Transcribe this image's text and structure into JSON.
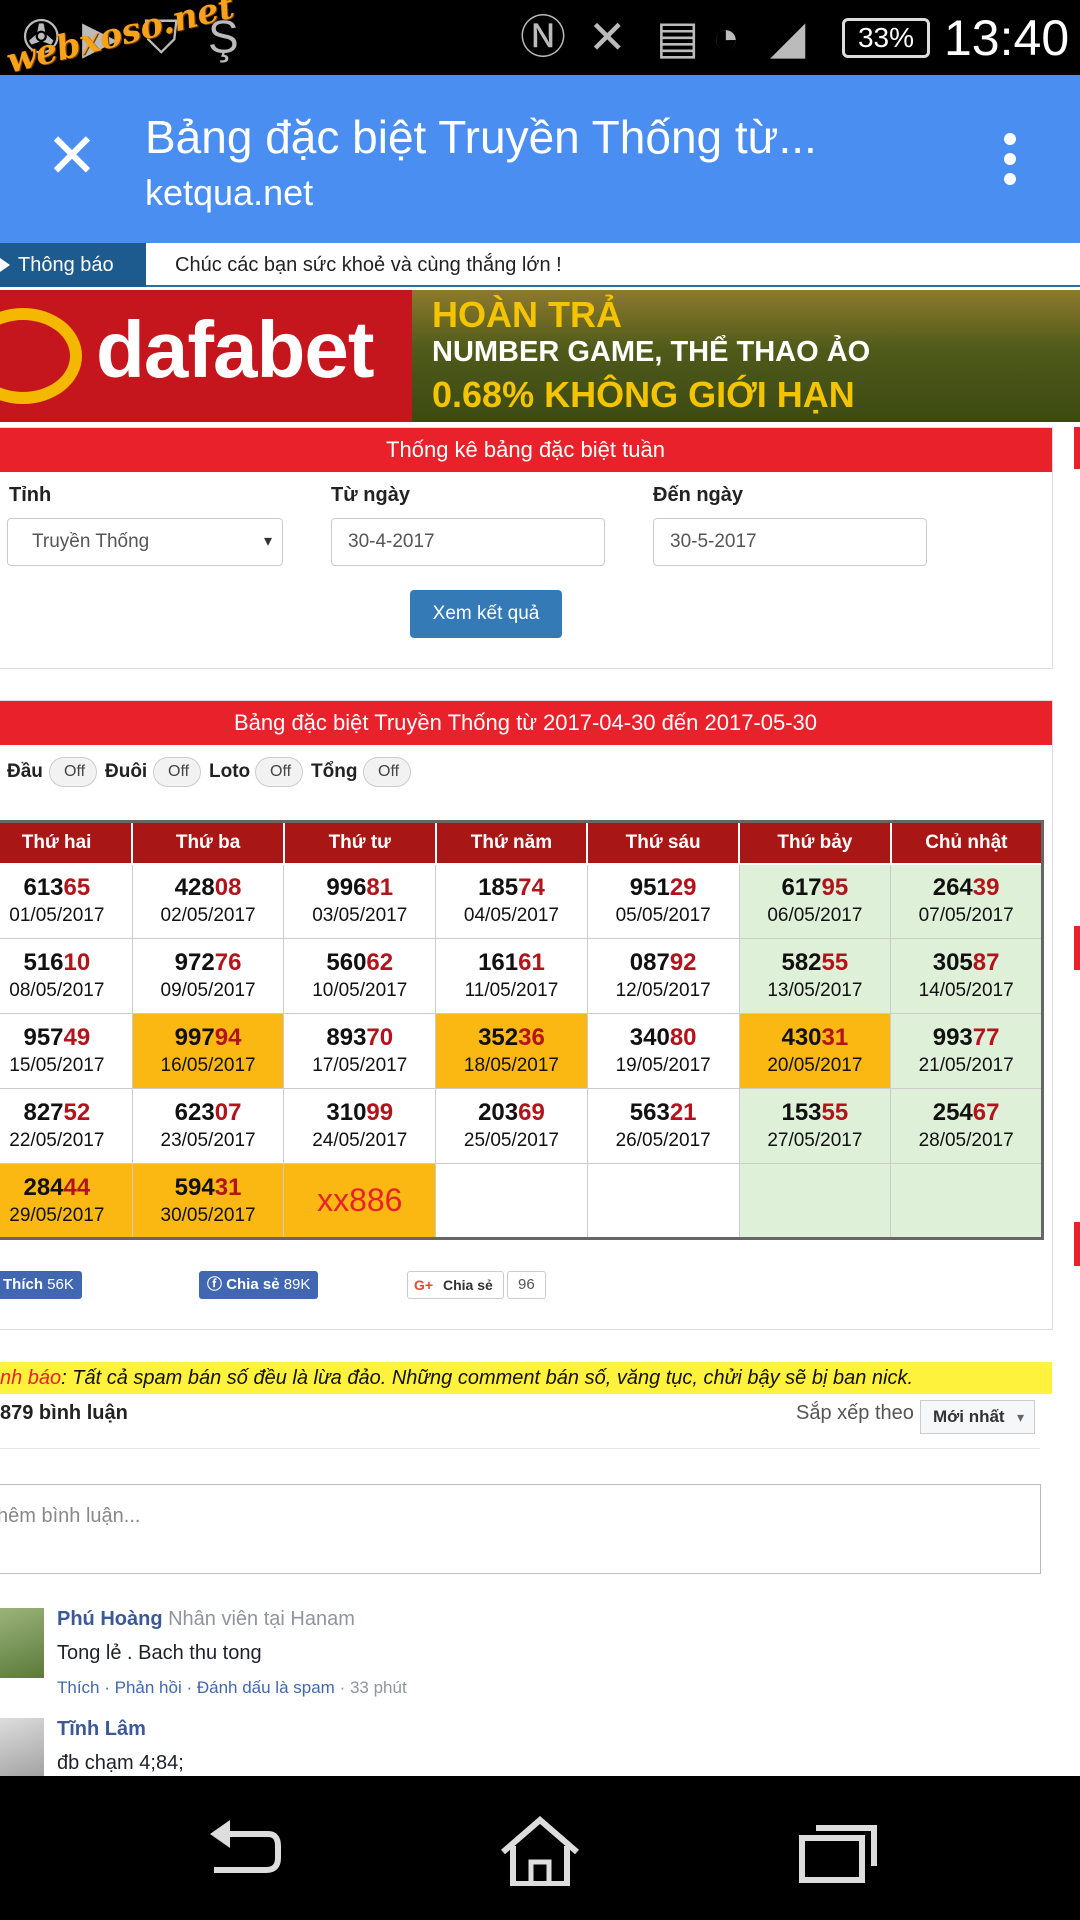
{
  "status_bar": {
    "watermark": "webxoso.net",
    "battery": "33%",
    "time": "13:40"
  },
  "app_bar": {
    "title": "Bảng đặc biệt Truyền Thống từ...",
    "domain": "ketqua.net"
  },
  "notice": {
    "tag": "Thông báo",
    "text": "Chúc các bạn sức khoẻ và cùng thắng lớn !"
  },
  "banner": {
    "logo": "dafabet",
    "line1": "HOÀN TRẢ",
    "line2": "NUMBER GAME, THỂ THAO ẢO",
    "line3": "0.68% KHÔNG GIỚI HẠN"
  },
  "filter": {
    "title": "Thống kê bảng đặc biệt tuần",
    "province_label": "Tỉnh",
    "province_value": "Truyền Thống",
    "from_label": "Từ ngày",
    "from_value": "30-4-2017",
    "to_label": "Đến ngày",
    "to_value": "30-5-2017",
    "submit_label": "Xem kết quả"
  },
  "results": {
    "title": "Bảng đặc biệt Truyền Thống từ 2017-04-30 đến 2017-05-30",
    "toggles": [
      {
        "label": "Đầu",
        "state": "Off"
      },
      {
        "label": "Đuôi",
        "state": "Off"
      },
      {
        "label": "Loto",
        "state": "Off"
      },
      {
        "label": "Tổng",
        "state": "Off"
      }
    ],
    "headers": [
      "Thứ hai",
      "Thứ ba",
      "Thứ tư",
      "Thứ năm",
      "Thứ sáu",
      "Thứ bảy",
      "Chủ nhật"
    ],
    "rows": [
      [
        {
          "head": "613",
          "tail": "65",
          "date": "01/05/2017"
        },
        {
          "head": "428",
          "tail": "08",
          "date": "02/05/2017"
        },
        {
          "head": "996",
          "tail": "81",
          "date": "03/05/2017"
        },
        {
          "head": "185",
          "tail": "74",
          "date": "04/05/2017"
        },
        {
          "head": "951",
          "tail": "29",
          "date": "05/05/2017"
        },
        {
          "head": "617",
          "tail": "95",
          "date": "06/05/2017"
        },
        {
          "head": "264",
          "tail": "39",
          "date": "07/05/2017"
        }
      ],
      [
        {
          "head": "516",
          "tail": "10",
          "date": "08/05/2017"
        },
        {
          "head": "972",
          "tail": "76",
          "date": "09/05/2017"
        },
        {
          "head": "560",
          "tail": "62",
          "date": "10/05/2017"
        },
        {
          "head": "161",
          "tail": "61",
          "date": "11/05/2017"
        },
        {
          "head": "087",
          "tail": "92",
          "date": "12/05/2017"
        },
        {
          "head": "582",
          "tail": "55",
          "date": "13/05/2017"
        },
        {
          "head": "305",
          "tail": "87",
          "date": "14/05/2017"
        }
      ],
      [
        {
          "head": "957",
          "tail": "49",
          "date": "15/05/2017"
        },
        {
          "head": "997",
          "tail": "94",
          "date": "16/05/2017",
          "highlight": true
        },
        {
          "head": "893",
          "tail": "70",
          "date": "17/05/2017"
        },
        {
          "head": "352",
          "tail": "36",
          "date": "18/05/2017",
          "highlight": true
        },
        {
          "head": "340",
          "tail": "80",
          "date": "19/05/2017"
        },
        {
          "head": "430",
          "tail": "31",
          "date": "20/05/2017",
          "highlight": true
        },
        {
          "head": "993",
          "tail": "77",
          "date": "21/05/2017"
        }
      ],
      [
        {
          "head": "827",
          "tail": "52",
          "date": "22/05/2017"
        },
        {
          "head": "623",
          "tail": "07",
          "date": "23/05/2017"
        },
        {
          "head": "310",
          "tail": "99",
          "date": "24/05/2017"
        },
        {
          "head": "203",
          "tail": "69",
          "date": "25/05/2017"
        },
        {
          "head": "563",
          "tail": "21",
          "date": "26/05/2017"
        },
        {
          "head": "153",
          "tail": "55",
          "date": "27/05/2017"
        },
        {
          "head": "254",
          "tail": "67",
          "date": "28/05/2017"
        }
      ],
      [
        {
          "head": "284",
          "tail": "44",
          "date": "29/05/2017",
          "highlight": true
        },
        {
          "head": "594",
          "tail": "31",
          "date": "30/05/2017",
          "highlight": true
        },
        {
          "pending": "xx886",
          "highlight": true
        },
        {},
        {},
        {},
        {}
      ]
    ],
    "colors": {
      "header_bg": "#a81616",
      "highlight_bg": "#fbb813",
      "weekend_bg": "#dff0d8",
      "tail_color": "#b3141c"
    }
  },
  "social": {
    "like_label": "Thích",
    "like_count": "56K",
    "share_label": "Chia sẻ",
    "share_count": "89K",
    "gplus_label": "Chia sẻ",
    "gplus_count": "96"
  },
  "comments": {
    "warning_label": "nh báo",
    "warning_text": ": Tất cả spam bán số đều là lừa đảo. Những comment bán số, văng tục, chửi bậy sẽ bị ban nick.",
    "count": "879 bình luận",
    "sort_label": "Sắp xếp theo",
    "sort_value": "Mới nhất",
    "input_placeholder": "hêm bình luận...",
    "items": [
      {
        "name": "Phú Hoàng",
        "meta": "Nhân viên tại Hanam",
        "text": "Tong lẻ . Bach thu tong",
        "actions": "Thích · Phản hồi · Đánh dấu là spam",
        "time": "· 33 phút"
      },
      {
        "name": "Tĩnh Lâm",
        "meta": "",
        "text": "đb chạm 4;84;"
      }
    ]
  }
}
